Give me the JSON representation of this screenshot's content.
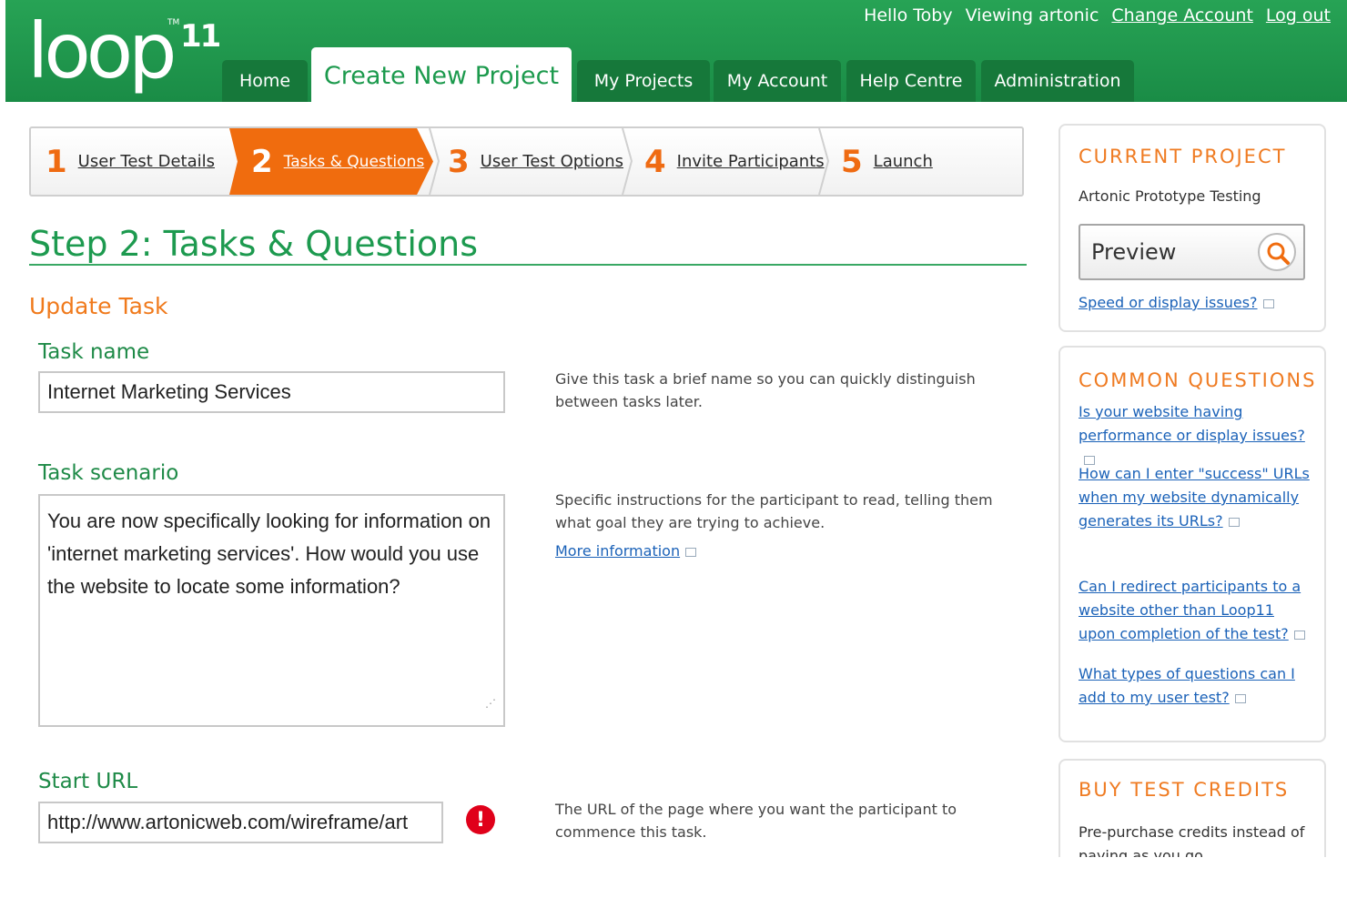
{
  "header": {
    "logo_text": "loop",
    "logo_sup": "11",
    "logo_tm": "TM",
    "greeting": "Hello Toby",
    "viewing": "Viewing artonic",
    "change_account": "Change Account",
    "logout": "Log out"
  },
  "nav": {
    "home": "Home",
    "create": "Create New Project",
    "my_projects": "My Projects",
    "my_account": "My Account",
    "help": "Help Centre",
    "admin": "Administration"
  },
  "steps": [
    {
      "num": "1",
      "label": "User Test Details"
    },
    {
      "num": "2",
      "label": "Tasks & Questions"
    },
    {
      "num": "3",
      "label": "User Test Options"
    },
    {
      "num": "4",
      "label": "Invite Participants"
    },
    {
      "num": "5",
      "label": "Launch"
    }
  ],
  "main": {
    "title": "Step 2: Tasks & Questions",
    "subtitle": "Update Task",
    "task_name_label": "Task name",
    "task_name_value": "Internet Marketing Services",
    "task_name_help": "Give this task a brief name so you can quickly distinguish between tasks later.",
    "scenario_label": "Task scenario",
    "scenario_value": "You are now specifically looking for information on 'internet marketing services'. How would you use the website to locate some information?",
    "scenario_help": "Specific instructions for the participant to read, telling them what goal they are trying to achieve.",
    "more_info": "More information",
    "start_url_label": "Start URL",
    "start_url_value": "http://www.artonicweb.com/wireframe/art",
    "start_url_help": "The URL of the page where you want the participant to commence this task.",
    "error_mark": "!"
  },
  "sidebar": {
    "current_title": "CURRENT PROJECT",
    "project_name": "Artonic Prototype Testing",
    "preview": "Preview",
    "speed_link": "Speed or display issues?",
    "questions_title": "COMMON QUESTIONS",
    "questions": [
      "Is your website having performance or display issues?",
      "How can I enter \"success\" URLs when my website dynamically generates its URLs?",
      "Can I redirect participants to a website other than Loop11 upon completion of the test?",
      "What types of questions can I add to my user test?"
    ],
    "credits_title": "BUY TEST CREDITS",
    "credits_text": "Pre-purchase credits instead of paying as you go."
  },
  "colors": {
    "brand_green": "#1d9a4f",
    "accent_orange": "#f06c0e",
    "link_blue": "#1b62b8",
    "error_red": "#e0001a"
  }
}
